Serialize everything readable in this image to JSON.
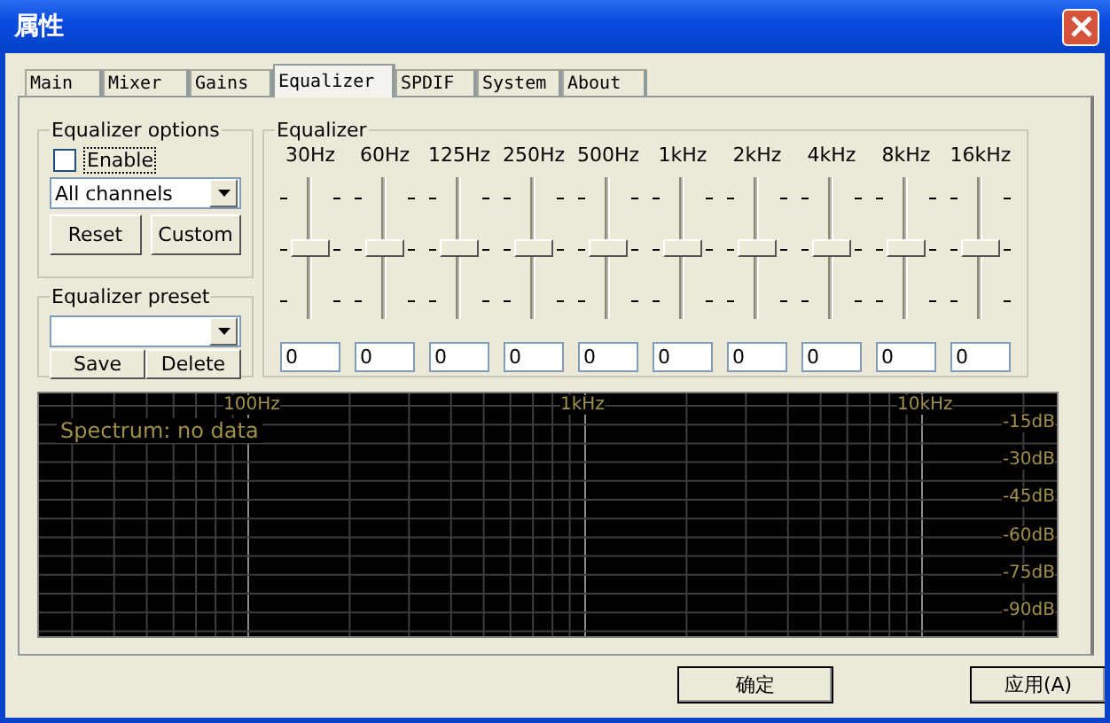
{
  "window": {
    "title": "属性"
  },
  "tabs": [
    {
      "label": "Main",
      "selected": false
    },
    {
      "label": "Mixer",
      "selected": false
    },
    {
      "label": "Gains",
      "selected": false
    },
    {
      "label": "Equalizer",
      "selected": true
    },
    {
      "label": "SPDIF",
      "selected": false
    },
    {
      "label": "System",
      "selected": false
    },
    {
      "label": "About",
      "selected": false
    }
  ],
  "equalizer_options": {
    "title": "Equalizer options",
    "enable": {
      "label": "Enable",
      "checked": false
    },
    "channels": {
      "value": "All channels"
    },
    "buttons": [
      "Reset",
      "Custom"
    ]
  },
  "equalizer_preset": {
    "title": "Equalizer preset",
    "buttons": [
      "Save",
      "Delete"
    ]
  },
  "equalizer": {
    "title": "Equalizer",
    "bands": [
      {
        "label": "30Hz",
        "level": 0.5,
        "value": "0"
      },
      {
        "label": "60Hz",
        "level": 0.5,
        "value": "0"
      },
      {
        "label": "125Hz",
        "level": 0.5,
        "value": "0"
      },
      {
        "label": "250Hz",
        "level": 0.5,
        "value": "0"
      },
      {
        "label": "500Hz",
        "level": 0.5,
        "value": "0"
      },
      {
        "label": "1kHz",
        "level": 0.5,
        "value": "0"
      },
      {
        "label": "2kHz",
        "level": 0.5,
        "value": "0"
      },
      {
        "label": "4kHz",
        "level": 0.5,
        "value": "0"
      },
      {
        "label": "8kHz",
        "level": 0.5,
        "value": "0"
      },
      {
        "label": "16kHz",
        "level": 0.5,
        "value": "0"
      }
    ]
  },
  "spectrum": {
    "message": "Spectrum: no data",
    "frequency_labels": [
      "100Hz",
      "1kHz",
      "10kHz"
    ],
    "db_labels": [
      "-15dB",
      "-30dB",
      "-45dB",
      "-60dB",
      "-75dB",
      "-90dB"
    ]
  },
  "buttons": [
    "确定",
    "应用(A)"
  ]
}
